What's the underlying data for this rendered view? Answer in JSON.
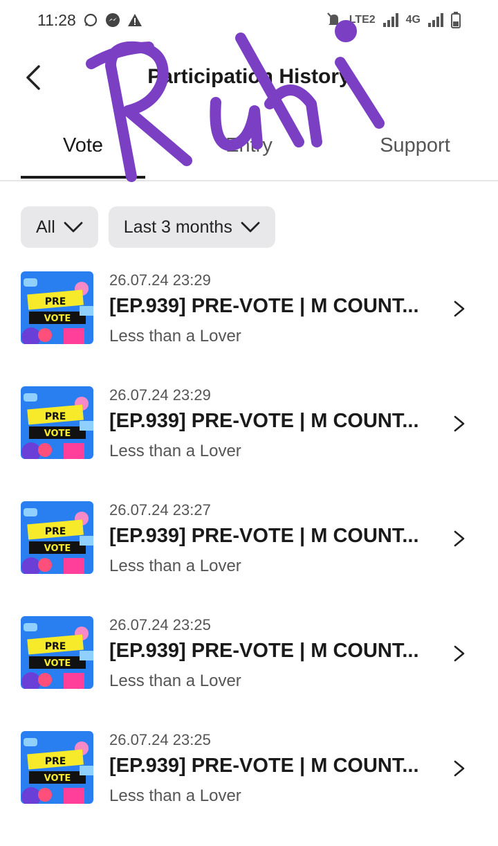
{
  "status_bar": {
    "time": "11:28",
    "network": "4G",
    "volte": "LTE2"
  },
  "header": {
    "title": "Participation History"
  },
  "tabs": [
    {
      "label": "Vote",
      "active": true
    },
    {
      "label": "Entry",
      "active": false
    },
    {
      "label": "Support",
      "active": false
    }
  ],
  "filters": {
    "type": "All",
    "period": "Last 3 months"
  },
  "items": [
    {
      "date": "26.07.24 23:29",
      "title": "[EP.939] PRE-VOTE | M COUNT...",
      "artist": "Less than a Lover",
      "thumb_text_1": "PRE",
      "thumb_text_2": "VOTE"
    },
    {
      "date": "26.07.24 23:29",
      "title": "[EP.939] PRE-VOTE | M COUNT...",
      "artist": "Less than a Lover",
      "thumb_text_1": "PRE",
      "thumb_text_2": "VOTE"
    },
    {
      "date": "26.07.24 23:27",
      "title": "[EP.939] PRE-VOTE | M COUNT...",
      "artist": "Less than a Lover",
      "thumb_text_1": "PRE",
      "thumb_text_2": "VOTE"
    },
    {
      "date": "26.07.24 23:25",
      "title": "[EP.939] PRE-VOTE | M COUNT...",
      "artist": "Less than a Lover",
      "thumb_text_1": "PRE",
      "thumb_text_2": "VOTE"
    },
    {
      "date": "26.07.24 23:25",
      "title": "[EP.939] PRE-VOTE | M COUNT...",
      "artist": "Less than a Lover",
      "thumb_text_1": "PRE",
      "thumb_text_2": "VOTE"
    }
  ],
  "handwriting_overlay": "Ruhi",
  "colors": {
    "accent": "#1a1a1a",
    "filter_bg": "#e8e8ea",
    "overlay_purple": "#7b3fc4"
  }
}
